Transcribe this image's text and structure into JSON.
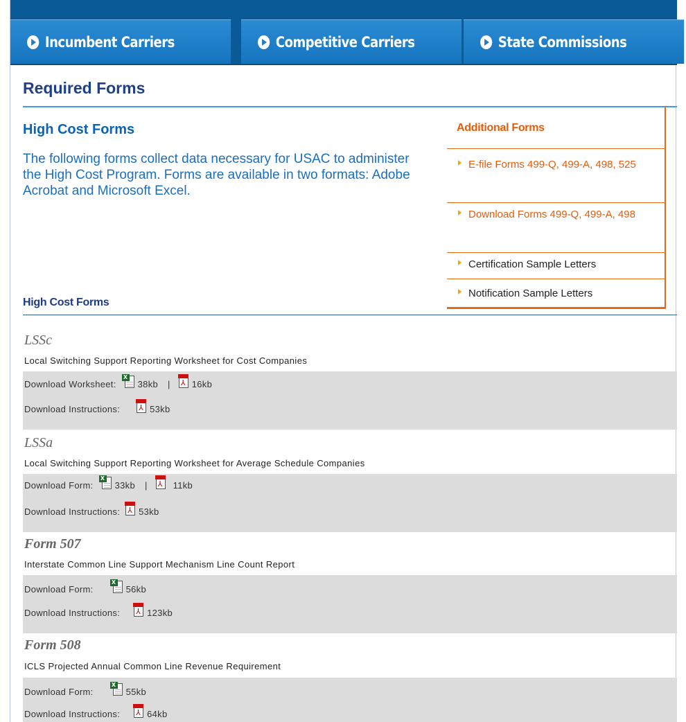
{
  "nav": {
    "incumbent": "Incumbent Carriers",
    "competitive": "Competitive Carriers",
    "state": "State Commissions"
  },
  "page_title": "Required Forms",
  "section_title": "High Cost Forms",
  "intro": "The following forms collect data necessary for USAC to administer the High Cost Program. Forms are available in two formats: Adobe Acrobat and Microsoft Excel.",
  "sidebar": {
    "title": "Additional Forms",
    "items": [
      {
        "label": "E-file Forms 499-Q, 499-A, 498, 525"
      },
      {
        "label": "Download Forms 499-Q, 499-A, 498"
      },
      {
        "label": "Certification Sample Letters"
      },
      {
        "label": "Notification Sample Letters"
      }
    ]
  },
  "forms_heading": "High Cost Forms",
  "forms": [
    {
      "name": "LSSc",
      "desc": "Local Switching Support Reporting Worksheet for Cost Companies",
      "row1_label": "Download Worksheet:",
      "row1_xls": "38kb",
      "row1_pdf": "16kb",
      "row2_label": "Download Instructions:",
      "row2_pdf": "53kb"
    },
    {
      "name": "LSSa",
      "desc": "Local Switching Support Reporting Worksheet for Average Schedule Companies",
      "row1_label": "Download Form:",
      "row1_xls": "33kb",
      "row1_pdf": "11kb",
      "row2_label": "Download Instructions:",
      "row2_pdf": "53kb"
    },
    {
      "name": "Form 507",
      "desc": "Interstate Common Line Support Mechanism Line Count Report",
      "row1_label": "Download Form:",
      "row1_xls": "56kb",
      "row2_label": "Download Instructions:",
      "row2_pdf": "123kb"
    },
    {
      "name": "Form 508",
      "desc": "ICLS Projected Annual Common Line Revenue Requirement",
      "row1_label": "Download Form:",
      "row1_xls": "55kb",
      "row2_label": "Download Instructions:",
      "row2_pdf": "64kb"
    }
  ],
  "separator": "|",
  "colors": {
    "nav_bg": "#0a5a98",
    "nav_button": "#1f7dc5",
    "title_blue": "#1f3f8c",
    "link_orange": "#e35d0c",
    "row_grey": "#dcdcdc"
  },
  "icons": [
    "arrow-circle-icon",
    "excel-file-icon",
    "pdf-file-icon",
    "triangle-bullet-icon"
  ]
}
